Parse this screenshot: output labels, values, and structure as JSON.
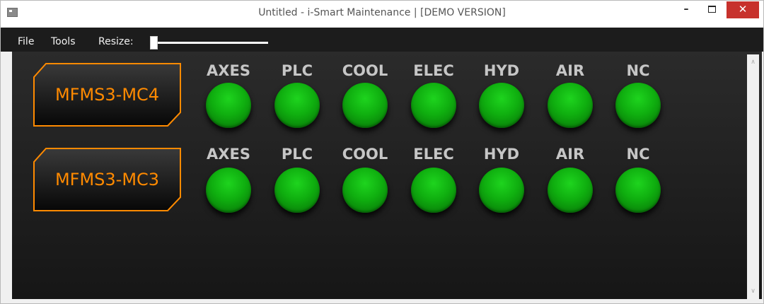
{
  "window": {
    "title": "Untitled - i-Smart Maintenance | [DEMO VERSION]",
    "icon": "app-icon",
    "controls": {
      "minimize": "–",
      "maximize": "maximize-icon",
      "close": "✕"
    }
  },
  "menubar": {
    "file": "File",
    "tools": "Tools",
    "resize_label": "Resize:",
    "resize_slider_value": 0
  },
  "scrollbar": {
    "up": "∧",
    "down": "∨"
  },
  "colors": {
    "machine_label_text": "#ff8a00",
    "machine_label_border": "#ff8a00",
    "status_ok": "#11b011",
    "status_label": "#c6c6c6",
    "background": "#1c1c1c"
  },
  "machines": [
    {
      "name": "MFMS3-MC4",
      "statuses": [
        {
          "label": "AXES",
          "state": "ok"
        },
        {
          "label": "PLC",
          "state": "ok"
        },
        {
          "label": "COOL",
          "state": "ok"
        },
        {
          "label": "ELEC",
          "state": "ok"
        },
        {
          "label": "HYD",
          "state": "ok"
        },
        {
          "label": "AIR",
          "state": "ok"
        },
        {
          "label": "NC",
          "state": "ok"
        }
      ]
    },
    {
      "name": "MFMS3-MC3",
      "statuses": [
        {
          "label": "AXES",
          "state": "ok"
        },
        {
          "label": "PLC",
          "state": "ok"
        },
        {
          "label": "COOL",
          "state": "ok"
        },
        {
          "label": "ELEC",
          "state": "ok"
        },
        {
          "label": "HYD",
          "state": "ok"
        },
        {
          "label": "AIR",
          "state": "ok"
        },
        {
          "label": "NC",
          "state": "ok"
        }
      ]
    }
  ]
}
